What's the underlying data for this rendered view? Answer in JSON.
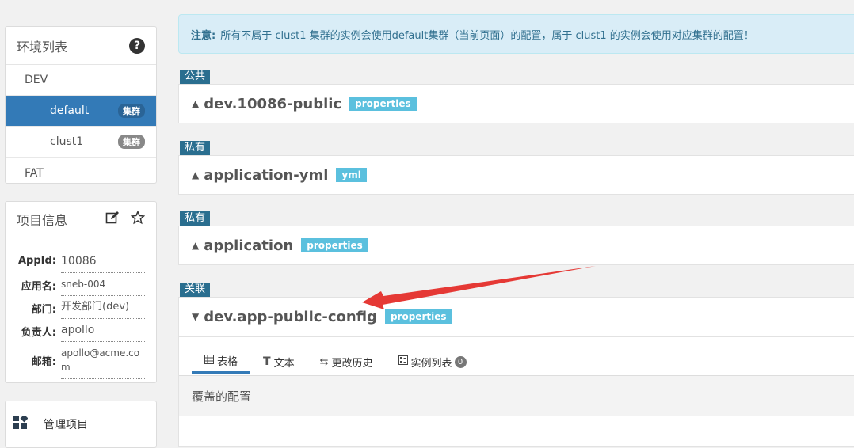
{
  "env_panel": {
    "title": "环境列表",
    "help_icon": "?",
    "items": [
      {
        "label": "DEV"
      },
      {
        "label": "default",
        "badge": "集群"
      },
      {
        "label": "clust1",
        "badge": "集群"
      },
      {
        "label": "FAT"
      }
    ]
  },
  "project_panel": {
    "title": "项目信息",
    "fields": [
      {
        "key": "AppId:",
        "value": "10086"
      },
      {
        "key": "应用名:",
        "value": "sneb-004"
      },
      {
        "key": "部门:",
        "value": "开发部门(dev)"
      },
      {
        "key": "负责人:",
        "value": "apollo"
      },
      {
        "key": "邮箱:",
        "value": "apollo@acme.com"
      }
    ]
  },
  "manage": {
    "label": "管理项目"
  },
  "notice": {
    "prefix": "注意:",
    "text": "所有不属于 clust1 集群的实例会使用default集群（当前页面）的配置，属于 clust1 的实例会使用对应集群的配置！"
  },
  "namespaces": [
    {
      "tag": "公共",
      "name": "dev.10086-public",
      "format": "properties",
      "caret": "▲"
    },
    {
      "tag": "私有",
      "name": "application-yml",
      "format": "yml",
      "caret": "▲"
    },
    {
      "tag": "私有",
      "name": "application",
      "format": "properties",
      "caret": "▲"
    },
    {
      "tag": "关联",
      "name": "dev.app-public-config",
      "format": "properties",
      "caret": "▼"
    }
  ],
  "detail": {
    "tabs": [
      {
        "label": "表格",
        "icon": "table-icon"
      },
      {
        "label": "文本",
        "icon": "text-icon"
      },
      {
        "label": "更改历史",
        "icon": "history-icon"
      },
      {
        "label": "实例列表",
        "icon": "instance-list-icon",
        "count": "0"
      }
    ],
    "section_title": "覆盖的配置"
  },
  "colors": {
    "primary": "#337ab7",
    "tag": "#2a6e8f",
    "format_badge": "#5bc0de",
    "notice_bg": "#d9edf7",
    "arrow": "#e53935"
  }
}
